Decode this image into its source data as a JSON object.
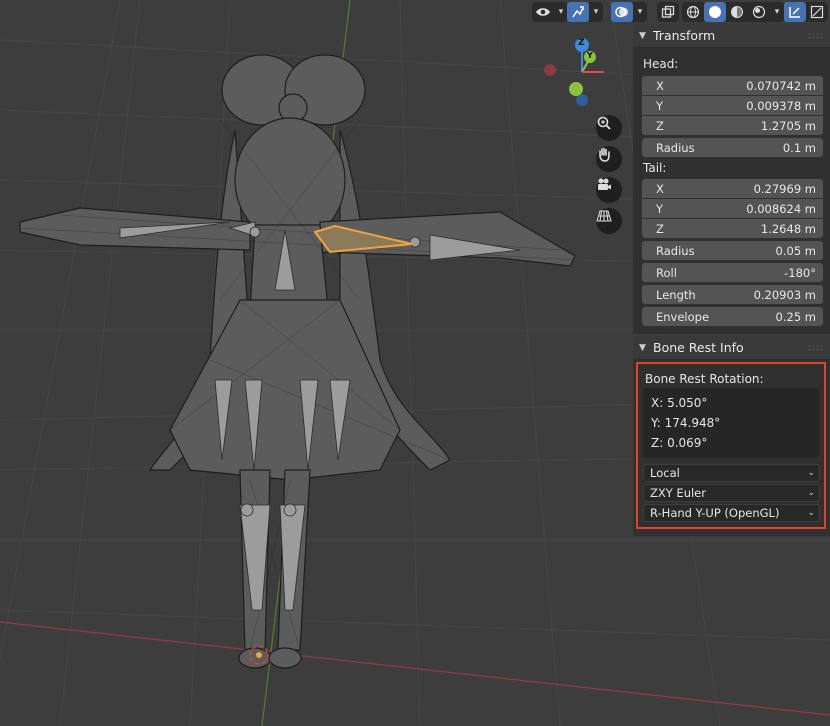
{
  "transform": {
    "title": "Transform",
    "head_label": "Head:",
    "head": {
      "x": "0.070742 m",
      "y": "0.009378 m",
      "z": "1.2705 m",
      "radius": "0.1 m"
    },
    "tail_label": "Tail:",
    "tail": {
      "x": "0.27969 m",
      "y": "0.008624 m",
      "z": "1.2648 m",
      "radius": "0.05 m"
    },
    "roll": "-180°",
    "length": "0.20903 m",
    "envelope": "0.25 m",
    "labels": {
      "x": "X",
      "y": "Y",
      "z": "Z",
      "radius": "Radius",
      "roll": "Roll",
      "length": "Length",
      "envelope": "Envelope"
    }
  },
  "bone_rest": {
    "title": "Bone Rest Info",
    "rotation_label": "Bone Rest Rotation:",
    "x": "X: 5.050°",
    "y": "Y: 174.948°",
    "z": "Z: 0.069°",
    "space": "Local",
    "order": "ZXY Euler",
    "convention": "R-Hand Y-UP (OpenGL)"
  },
  "gizmo": {
    "x": "X",
    "y": "Y",
    "z": "Z"
  },
  "icons": {
    "header": [
      "visibility-eye-icon",
      "gizmo-icon",
      "overlay-icon",
      "xray-icon",
      "wireframe-shading-icon",
      "solid-shading-icon",
      "material-shading-icon",
      "rendered-shading-icon",
      "snap-icon",
      "proportional-icon"
    ],
    "nav": [
      "zoom-icon",
      "pan-hand-icon",
      "camera-icon",
      "perspective-grid-icon"
    ]
  },
  "colors": {
    "viewport_bg": "#3d3d3d",
    "accent": "#4772b3",
    "highlight_border": "#e0452a",
    "axis_x": "#e54754",
    "axis_y": "#8bc43a",
    "axis_z": "#3d8bdc"
  }
}
